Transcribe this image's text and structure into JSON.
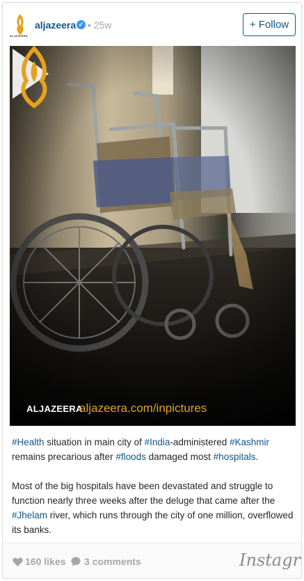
{
  "header": {
    "logo_caption": "ALJAZEERA",
    "username": "aljazeera",
    "verified_icon": "verified-check-icon",
    "separator": "•",
    "time": "25w",
    "follow_label": "+ Follow"
  },
  "media": {
    "play_icon": "play-icon",
    "brand_name": "ALJAZEERA",
    "brand_url": "aljazeera.com/inpictures"
  },
  "caption": {
    "p1": [
      {
        "t": "#Health",
        "tag": true
      },
      {
        "t": " situation in main city of ",
        "tag": false
      },
      {
        "t": "#India",
        "tag": true
      },
      {
        "t": "-administered ",
        "tag": false
      },
      {
        "t": "#Kashmir",
        "tag": true
      },
      {
        "t": " remains precarious after ",
        "tag": false
      },
      {
        "t": "#floods",
        "tag": true
      },
      {
        "t": " damaged most ",
        "tag": false
      },
      {
        "t": "#hospitals",
        "tag": true
      },
      {
        "t": ".",
        "tag": false
      }
    ],
    "p2": [
      {
        "t": "Most of the big hospitals have been devastated and struggle to function nearly three weeks after the deluge that came after the ",
        "tag": false
      },
      {
        "t": "#Jhelam",
        "tag": true
      },
      {
        "t": " river, which runs through the city of one million, overflowed its banks.",
        "tag": false
      }
    ]
  },
  "footer": {
    "likes": "160 likes",
    "comments": "3 comments",
    "brand": "Instagram"
  },
  "colors": {
    "link": "#125688",
    "muted": "#a5a7aa",
    "brand_gold": "#e6a21e"
  }
}
